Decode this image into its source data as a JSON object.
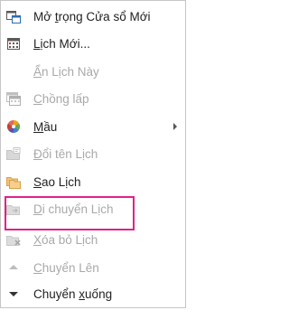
{
  "colors": {
    "highlight": "#e0218a",
    "disabled_text": "#a9a9a9",
    "enabled_text": "#222222"
  },
  "menu": {
    "items": [
      {
        "id": "open-new-window",
        "label_pre": "Mở ",
        "label_u": "t",
        "label_post": "rọng Cửa sổ Mới",
        "icon": "new-window-icon",
        "disabled": false
      },
      {
        "id": "new-calendar",
        "label_pre": "",
        "label_u": "L",
        "label_post": "ịch Mới...",
        "icon": "new-calendar-icon",
        "disabled": false
      },
      {
        "id": "hide-calendar",
        "label_pre": "",
        "label_u": "Ẩ",
        "label_post": "n Lịch Này",
        "icon": "",
        "disabled": true
      },
      {
        "id": "overlay",
        "label_pre": "",
        "label_u": "C",
        "label_post": "hồng lấp",
        "icon": "overlay-icon",
        "disabled": true
      },
      {
        "id": "color",
        "label_pre": "",
        "label_u": "M",
        "label_post": "ầu",
        "icon": "color-wheel-icon",
        "disabled": false,
        "submenu": true
      },
      {
        "id": "rename-calendar",
        "label_pre": "",
        "label_u": "Đ",
        "label_post": "ổi tên Lịch",
        "icon": "rename-folder-icon",
        "disabled": true
      },
      {
        "id": "copy-calendar",
        "label_pre": "",
        "label_u": "S",
        "label_post": "ao Lịch",
        "icon": "copy-folder-icon",
        "disabled": false
      },
      {
        "id": "move-calendar",
        "label_pre": "",
        "label_u": "D",
        "label_post": "i chuyển Lịch",
        "icon": "move-folder-icon",
        "disabled": true
      },
      {
        "id": "delete-calendar",
        "label_pre": "",
        "label_u": "X",
        "label_post": "óa bỏ Lịch",
        "icon": "delete-folder-icon",
        "disabled": true
      },
      {
        "id": "move-up",
        "label_pre": "",
        "label_u": "C",
        "label_post": "huyển Lên",
        "icon": "triangle-up-icon",
        "disabled": true
      },
      {
        "id": "move-down",
        "label_pre": "Chuyển ",
        "label_u": "x",
        "label_post": "uống",
        "icon": "triangle-down-icon",
        "disabled": false
      }
    ]
  }
}
